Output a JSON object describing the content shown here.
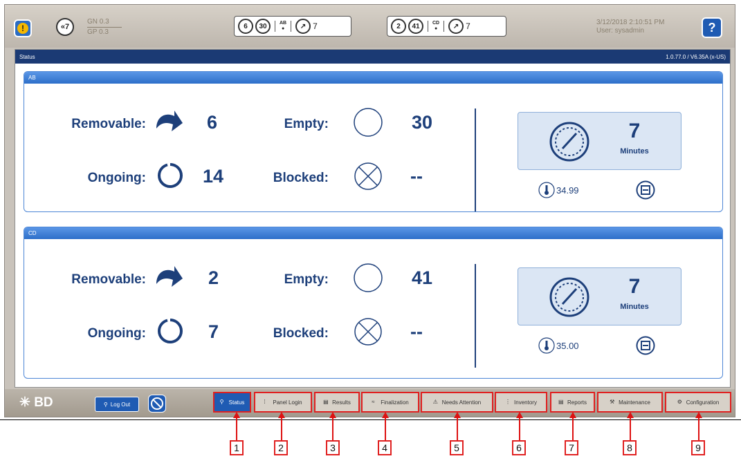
{
  "topbar": {
    "alert_count": "«7",
    "gn_label": "GN 0.3",
    "gp_label": "GP 0.3",
    "ab_group": {
      "removable": "6",
      "empty": "30",
      "label": "AB",
      "minutes": "7"
    },
    "cd_group": {
      "removable": "2",
      "empty": "41",
      "label": "CD",
      "minutes": "7"
    },
    "datetime": "3/12/2018 2:10:51 PM",
    "user": "User: sysadmin",
    "help_label": "?"
  },
  "status": {
    "title": "Status",
    "version": "1.0.77.0 / V6.35A (x-US)"
  },
  "panels": [
    {
      "name": "AB",
      "removable_label": "Removable:",
      "removable_value": "6",
      "empty_label": "Empty:",
      "empty_value": "30",
      "ongoing_label": "Ongoing:",
      "ongoing_value": "14",
      "blocked_label": "Blocked:",
      "blocked_value": "--",
      "minutes_value": "7",
      "minutes_unit": "Minutes",
      "temperature": "34.99"
    },
    {
      "name": "CD",
      "removable_label": "Removable:",
      "removable_value": "2",
      "empty_label": "Empty:",
      "empty_value": "41",
      "ongoing_label": "Ongoing:",
      "ongoing_value": "7",
      "blocked_label": "Blocked:",
      "blocked_value": "--",
      "minutes_value": "7",
      "minutes_unit": "Minutes",
      "temperature": "35.00"
    }
  ],
  "footer": {
    "logo": "BD",
    "logout_label": "Log Out",
    "nav": [
      {
        "label": "Status",
        "icon": "status-icon"
      },
      {
        "label": "Panel Login",
        "icon": "panel-login-icon"
      },
      {
        "label": "Results",
        "icon": "results-icon"
      },
      {
        "label": "Finalization",
        "icon": "finalization-icon"
      },
      {
        "label": "Needs Attention",
        "icon": "needs-attention-icon"
      },
      {
        "label": "Inventory",
        "icon": "inventory-icon"
      },
      {
        "label": "Reports",
        "icon": "reports-icon"
      },
      {
        "label": "Maintenance",
        "icon": "maintenance-icon"
      },
      {
        "label": "Configuration",
        "icon": "configuration-icon"
      }
    ]
  },
  "callouts": [
    "1",
    "2",
    "3",
    "4",
    "5",
    "6",
    "7",
    "8",
    "9"
  ],
  "colors": {
    "accent": "#1f5bb3",
    "label_text": "#1d3f7a",
    "callout_red": "#e02020"
  }
}
